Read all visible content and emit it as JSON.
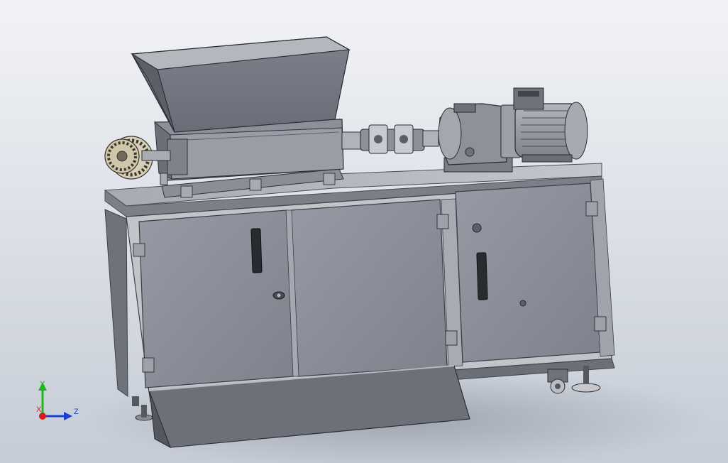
{
  "triad": {
    "y_label": "Y",
    "z_label": "Z",
    "x_label": "X"
  },
  "colors": {
    "bg_top": "#eef0f4",
    "bg_bottom": "#c9cfd8",
    "cabinet_body": "#8f929b",
    "door_panel": "#8b8e99",
    "frame_dark": "#5c5f67",
    "frame_light": "#b9bcc3",
    "machine_gray": "#7e818c",
    "motor_gray": "#9ea2ab",
    "axis_y": "#1db81d",
    "axis_z": "#1d3fd6",
    "axis_x": "#d61d1d"
  }
}
